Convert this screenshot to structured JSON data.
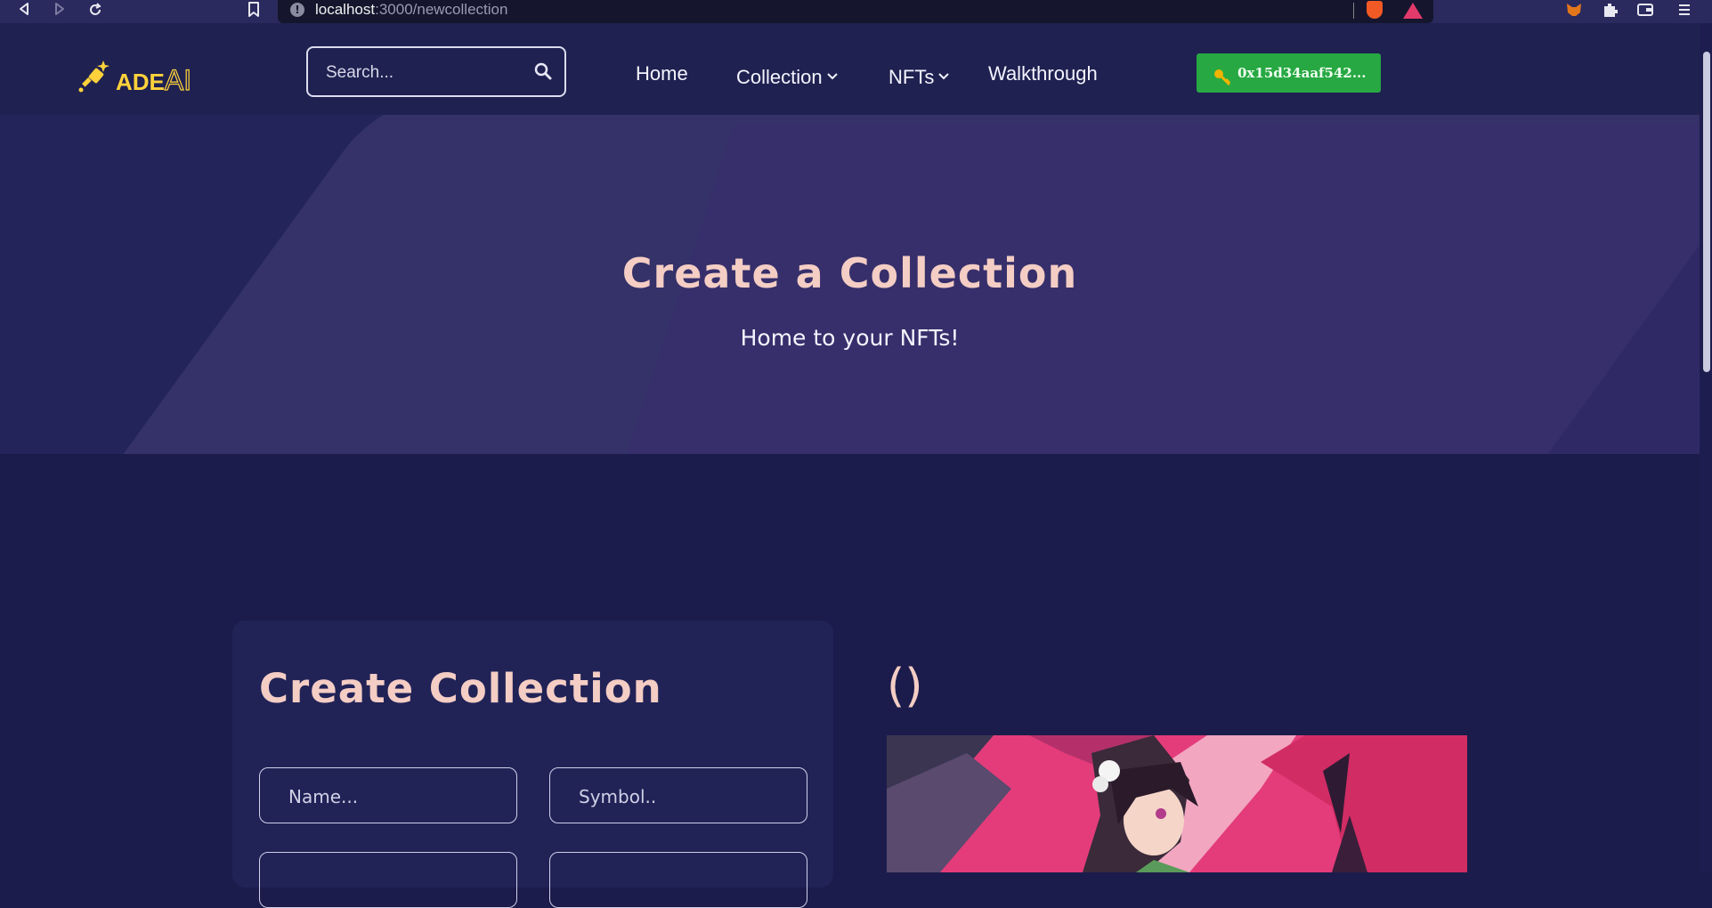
{
  "browser": {
    "url_host": "localhost",
    "url_path": ":3000/newcollection"
  },
  "header": {
    "logo_text": "ADE",
    "logo_suffix": "AI",
    "search_placeholder": "Search...",
    "nav": [
      {
        "label": "Home"
      },
      {
        "label": "Collection"
      },
      {
        "label": "NFTs"
      },
      {
        "label": "Walkthrough"
      }
    ],
    "wallet_address": "0x15d34aaf542..."
  },
  "hero": {
    "title": "Create a Collection",
    "subtitle": "Home to your NFTs!"
  },
  "form": {
    "title": "Create Collection",
    "name_placeholder": "Name...",
    "symbol_placeholder": "Symbol.."
  },
  "preview": {
    "title": "()"
  },
  "colors": {
    "page_bg": "#1b1c4b",
    "header_bg": "#1f2150",
    "accent_title": "#f4cdc4",
    "wallet_button": "#27a843",
    "logo": "#ffd23b"
  }
}
